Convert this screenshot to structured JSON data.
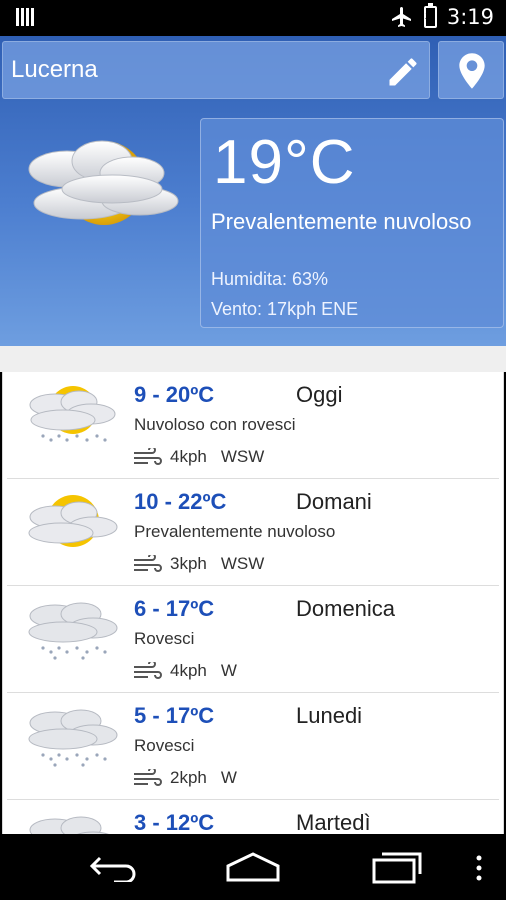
{
  "status_bar": {
    "time": "3:19"
  },
  "header": {
    "city": "Lucerna",
    "current": {
      "temperature": "19°C",
      "condition": "Prevalentemente nuvoloso",
      "humidity": "Humidita: 63%",
      "wind": "Vento: 17kph ENE"
    }
  },
  "forecast": [
    {
      "range": "9 - 20ºC",
      "day": "Oggi",
      "desc": "Nuvoloso con rovesci",
      "wind_speed": "4kph",
      "wind_dir": "WSW",
      "icon": "partly-cloudy-showers-icon"
    },
    {
      "range": "10 - 22ºC",
      "day": "Domani",
      "desc": "Prevalentemente nuvoloso",
      "wind_speed": "3kph",
      "wind_dir": "WSW",
      "icon": "partly-cloudy-icon"
    },
    {
      "range": "6 - 17ºC",
      "day": "Domenica",
      "desc": "Rovesci",
      "wind_speed": "4kph",
      "wind_dir": "W",
      "icon": "showers-icon"
    },
    {
      "range": "5 - 17ºC",
      "day": "Lunedi",
      "desc": "Rovesci",
      "wind_speed": "2kph",
      "wind_dir": "W",
      "icon": "showers-icon"
    },
    {
      "range": "3 - 12ºC",
      "day": "Martedì",
      "desc": "",
      "wind_speed": "",
      "wind_dir": "",
      "icon": "showers-icon"
    }
  ],
  "colors": {
    "header_blue": "#4d7fd0",
    "range_blue": "#1d4fb8"
  }
}
